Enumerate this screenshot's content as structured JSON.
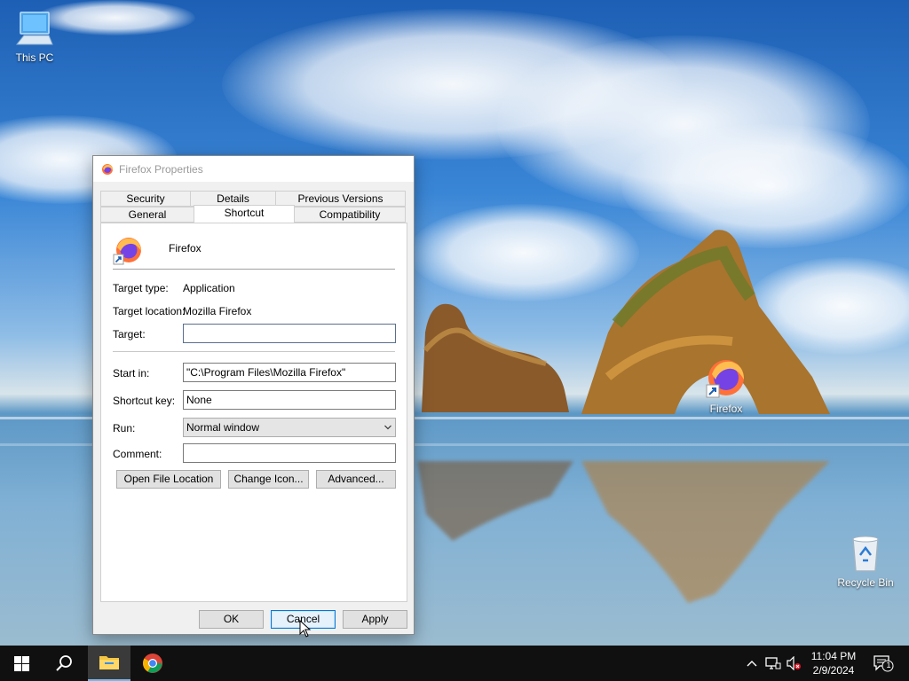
{
  "desktop": {
    "icons": [
      {
        "label": "This PC"
      },
      {
        "label": "Firefox"
      },
      {
        "label": "Recycle Bin"
      }
    ]
  },
  "dialog": {
    "title": "Firefox Properties",
    "tabs_row1": [
      "Security",
      "Details",
      "Previous Versions"
    ],
    "tabs_row2": [
      "General",
      "Shortcut",
      "Compatibility"
    ],
    "active_tab": "Shortcut",
    "app_name": "Firefox",
    "target_type_label": "Target type:",
    "target_type_value": "Application",
    "target_location_label": "Target location:",
    "target_location_value": "Mozilla Firefox",
    "target_label": "Target:",
    "target_value": "",
    "start_in_label": "Start in:",
    "start_in_value": "\"C:\\Program Files\\Mozilla Firefox\"",
    "shortcut_key_label": "Shortcut key:",
    "shortcut_key_value": "None",
    "run_label": "Run:",
    "run_value": "Normal window",
    "comment_label": "Comment:",
    "comment_value": "",
    "buttons": {
      "open_file_location": "Open File Location",
      "change_icon": "Change Icon...",
      "advanced": "Advanced...",
      "ok": "OK",
      "cancel": "Cancel",
      "apply": "Apply"
    }
  },
  "taskbar": {
    "time": "11:04 PM",
    "date": "2/9/2024",
    "notification_count": "1",
    "pinned": [
      "start-icon",
      "search-icon",
      "file-explorer-icon",
      "chrome-icon"
    ]
  },
  "colors": {
    "accent": "#0078d7",
    "taskbar": "#101010",
    "dialog_bg": "#f0f0f0"
  }
}
